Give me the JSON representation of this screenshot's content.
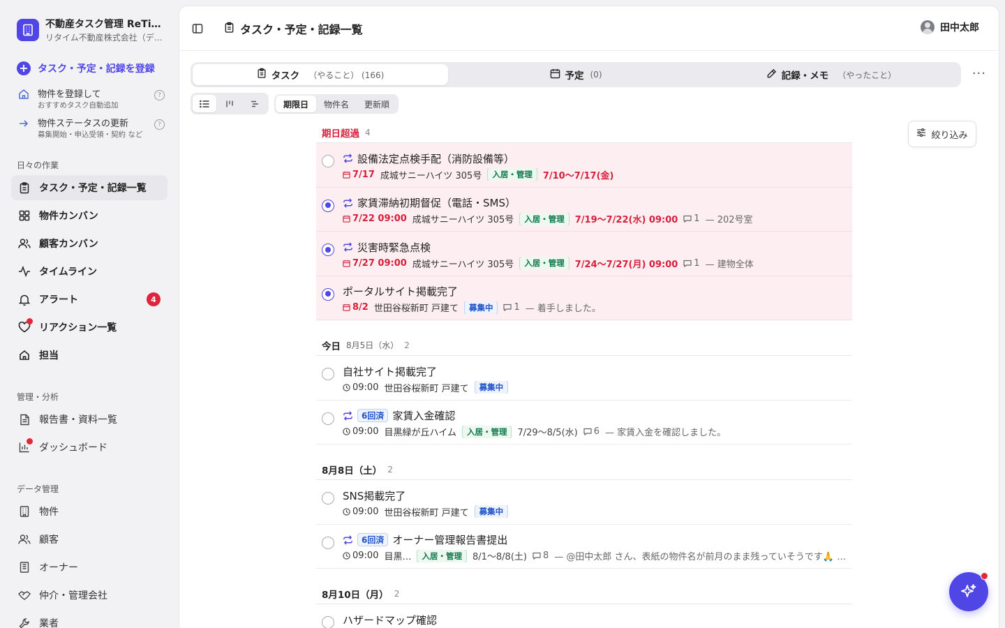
{
  "sidebar": {
    "brand_name": "不動産タスク管理 ReTime",
    "brand_sub": "リタイム不動産株式会社（デモ）",
    "register_label": "タスク・予定・記録を登録",
    "quick": [
      {
        "title": "物件を登録して",
        "sub": "おすすめタスク自動追加"
      },
      {
        "title": "物件ステータスの更新",
        "sub": "募集開始・申込受領・契約 など"
      }
    ],
    "help_glyph": "?",
    "section_daily": "日々の作業",
    "daily_items": [
      {
        "label": "タスク・予定・記録一覧",
        "icon": "clipboard-icon"
      },
      {
        "label": "物件カンバン",
        "icon": "grid-icon"
      },
      {
        "label": "顧客カンバン",
        "icon": "users-icon"
      },
      {
        "label": "タイムライン",
        "icon": "activity-icon"
      },
      {
        "label": "アラート",
        "icon": "bell-icon",
        "badge": "4"
      },
      {
        "label": "リアクション一覧",
        "icon": "heart-icon"
      },
      {
        "label": "担当",
        "icon": "home-icon"
      }
    ],
    "section_manage": "管理・分析",
    "manage_items": [
      {
        "label": "報告書・資料一覧",
        "icon": "document-icon"
      },
      {
        "label": "ダッシュボード",
        "icon": "bar-chart-icon"
      }
    ],
    "section_data": "データ管理",
    "data_items": [
      {
        "label": "物件",
        "icon": "building-icon"
      },
      {
        "label": "顧客",
        "icon": "users-icon"
      },
      {
        "label": "オーナー",
        "icon": "building-icon"
      },
      {
        "label": "仲介・管理会社",
        "icon": "handshake-icon"
      },
      {
        "label": "業者",
        "icon": "tool-icon"
      }
    ]
  },
  "header": {
    "title": "タスク・予定・記録一覧",
    "user_name": "田中太郎"
  },
  "tabs": [
    {
      "label": "タスク",
      "sub": "（やること）",
      "count": "(166)",
      "icon": "clipboard-icon"
    },
    {
      "label": "予定",
      "sub": "",
      "count": "(0)",
      "icon": "calendar-icon"
    },
    {
      "label": "記録・メモ",
      "sub": "（やったこと）",
      "count": "",
      "icon": "pencil-icon"
    }
  ],
  "more_label": "···",
  "sort_options": [
    "期限日",
    "物件名",
    "更新順"
  ],
  "filter_label": "絞り込み",
  "groups": [
    {
      "title": "期日超過",
      "subtitle": "",
      "count": "4",
      "overdue": true,
      "tasks": [
        {
          "title": "設備法定点検手配（消防設備等）",
          "repeat": true,
          "repeat_badge": "",
          "selected": false,
          "due": "7/17",
          "due_type": "calendar",
          "property": "成城サニーハイツ 305号",
          "tag": "入居・管理",
          "tag_color": "green",
          "period": "7/10〜7/17(金)",
          "comments": "",
          "note": ""
        },
        {
          "title": "家賃滞納初期督促（電話・SMS）",
          "repeat": true,
          "repeat_badge": "",
          "selected": true,
          "due": "7/22 09:00",
          "due_type": "calendar",
          "property": "成城サニーハイツ 305号",
          "tag": "入居・管理",
          "tag_color": "green",
          "period": "7/19〜7/22(水) 09:00",
          "comments": "1",
          "note": "— 202号室"
        },
        {
          "title": "災害時緊急点検",
          "repeat": true,
          "repeat_badge": "",
          "selected": true,
          "due": "7/27 09:00",
          "due_type": "calendar",
          "property": "成城サニーハイツ 305号",
          "tag": "入居・管理",
          "tag_color": "green",
          "period": "7/24〜7/27(月) 09:00",
          "comments": "1",
          "note": "— 建物全体"
        },
        {
          "title": "ポータルサイト掲載完了",
          "repeat": false,
          "repeat_badge": "",
          "selected": true,
          "due": "8/2",
          "due_type": "calendar",
          "property": "世田谷桜新町 戸建て",
          "tag": "募集中",
          "tag_color": "blue",
          "period": "",
          "comments": "1",
          "note": "— 着手しました。"
        }
      ]
    },
    {
      "title": "今日",
      "subtitle": "8月5日（水）",
      "count": "2",
      "overdue": false,
      "tasks": [
        {
          "title": "自社サイト掲載完了",
          "repeat": false,
          "repeat_badge": "",
          "selected": false,
          "due": "09:00",
          "due_type": "clock",
          "property": "世田谷桜新町 戸建て",
          "tag": "募集中",
          "tag_color": "blue",
          "period": "",
          "comments": "",
          "note": ""
        },
        {
          "title": "家賃入金確認",
          "repeat": true,
          "repeat_badge": "6回済",
          "selected": false,
          "due": "09:00",
          "due_type": "clock",
          "property": "目黒緑が丘ハイム",
          "tag": "入居・管理",
          "tag_color": "green",
          "period": "7/29〜8/5(水)",
          "comments": "6",
          "note": "— 家賃入金を確認しました。"
        }
      ]
    },
    {
      "title": "8月8日（土）",
      "subtitle": "",
      "count": "2",
      "overdue": false,
      "tasks": [
        {
          "title": "SNS掲載完了",
          "repeat": false,
          "repeat_badge": "",
          "selected": false,
          "due": "09:00",
          "due_type": "clock",
          "property": "世田谷桜新町 戸建て",
          "tag": "募集中",
          "tag_color": "blue",
          "period": "",
          "comments": "",
          "note": ""
        },
        {
          "title": "オーナー管理報告書提出",
          "repeat": true,
          "repeat_badge": "6回済",
          "selected": false,
          "due": "09:00",
          "due_type": "clock",
          "property": "目黒…",
          "tag": "入居・管理",
          "tag_color": "green",
          "period": "8/1〜8/8(土)",
          "comments": "8",
          "note": "— @田中太郎 さん、表紙の物件名が前月のまま残っていそうです🙏 …"
        }
      ]
    },
    {
      "title": "8月10日（月）",
      "subtitle": "",
      "count": "2",
      "overdue": false,
      "tasks": [
        {
          "title": "ハザードマップ確認",
          "repeat": false,
          "repeat_badge": "",
          "selected": false,
          "due": "",
          "due_type": "clock",
          "property": "",
          "tag": "",
          "tag_color": "green",
          "period": "",
          "comments": "",
          "note": ""
        }
      ]
    }
  ],
  "colors": {
    "accent": "#4f46e5",
    "overdue": "#d61f3c",
    "overdue_bg": "#fdeff1"
  }
}
